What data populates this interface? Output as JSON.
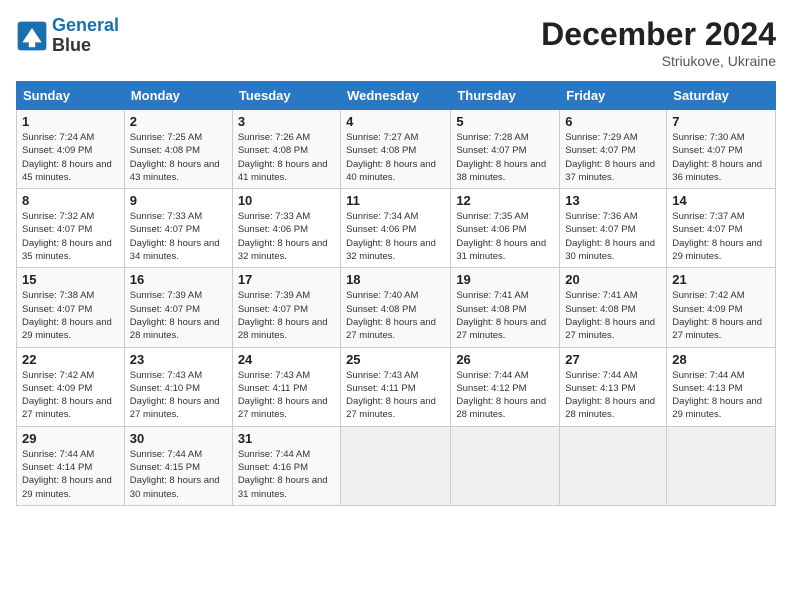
{
  "header": {
    "logo_line1": "General",
    "logo_line2": "Blue",
    "month": "December 2024",
    "location": "Striukove, Ukraine"
  },
  "weekdays": [
    "Sunday",
    "Monday",
    "Tuesday",
    "Wednesday",
    "Thursday",
    "Friday",
    "Saturday"
  ],
  "weeks": [
    [
      {
        "day": 1,
        "sunrise": "7:24 AM",
        "sunset": "4:09 PM",
        "daylight": "8 hours and 45 minutes."
      },
      {
        "day": 2,
        "sunrise": "7:25 AM",
        "sunset": "4:08 PM",
        "daylight": "8 hours and 43 minutes."
      },
      {
        "day": 3,
        "sunrise": "7:26 AM",
        "sunset": "4:08 PM",
        "daylight": "8 hours and 41 minutes."
      },
      {
        "day": 4,
        "sunrise": "7:27 AM",
        "sunset": "4:08 PM",
        "daylight": "8 hours and 40 minutes."
      },
      {
        "day": 5,
        "sunrise": "7:28 AM",
        "sunset": "4:07 PM",
        "daylight": "8 hours and 38 minutes."
      },
      {
        "day": 6,
        "sunrise": "7:29 AM",
        "sunset": "4:07 PM",
        "daylight": "8 hours and 37 minutes."
      },
      {
        "day": 7,
        "sunrise": "7:30 AM",
        "sunset": "4:07 PM",
        "daylight": "8 hours and 36 minutes."
      }
    ],
    [
      {
        "day": 8,
        "sunrise": "7:32 AM",
        "sunset": "4:07 PM",
        "daylight": "8 hours and 35 minutes."
      },
      {
        "day": 9,
        "sunrise": "7:33 AM",
        "sunset": "4:07 PM",
        "daylight": "8 hours and 34 minutes."
      },
      {
        "day": 10,
        "sunrise": "7:33 AM",
        "sunset": "4:06 PM",
        "daylight": "8 hours and 32 minutes."
      },
      {
        "day": 11,
        "sunrise": "7:34 AM",
        "sunset": "4:06 PM",
        "daylight": "8 hours and 32 minutes."
      },
      {
        "day": 12,
        "sunrise": "7:35 AM",
        "sunset": "4:06 PM",
        "daylight": "8 hours and 31 minutes."
      },
      {
        "day": 13,
        "sunrise": "7:36 AM",
        "sunset": "4:07 PM",
        "daylight": "8 hours and 30 minutes."
      },
      {
        "day": 14,
        "sunrise": "7:37 AM",
        "sunset": "4:07 PM",
        "daylight": "8 hours and 29 minutes."
      }
    ],
    [
      {
        "day": 15,
        "sunrise": "7:38 AM",
        "sunset": "4:07 PM",
        "daylight": "8 hours and 29 minutes."
      },
      {
        "day": 16,
        "sunrise": "7:39 AM",
        "sunset": "4:07 PM",
        "daylight": "8 hours and 28 minutes."
      },
      {
        "day": 17,
        "sunrise": "7:39 AM",
        "sunset": "4:07 PM",
        "daylight": "8 hours and 28 minutes."
      },
      {
        "day": 18,
        "sunrise": "7:40 AM",
        "sunset": "4:08 PM",
        "daylight": "8 hours and 27 minutes."
      },
      {
        "day": 19,
        "sunrise": "7:41 AM",
        "sunset": "4:08 PM",
        "daylight": "8 hours and 27 minutes."
      },
      {
        "day": 20,
        "sunrise": "7:41 AM",
        "sunset": "4:08 PM",
        "daylight": "8 hours and 27 minutes."
      },
      {
        "day": 21,
        "sunrise": "7:42 AM",
        "sunset": "4:09 PM",
        "daylight": "8 hours and 27 minutes."
      }
    ],
    [
      {
        "day": 22,
        "sunrise": "7:42 AM",
        "sunset": "4:09 PM",
        "daylight": "8 hours and 27 minutes."
      },
      {
        "day": 23,
        "sunrise": "7:43 AM",
        "sunset": "4:10 PM",
        "daylight": "8 hours and 27 minutes."
      },
      {
        "day": 24,
        "sunrise": "7:43 AM",
        "sunset": "4:11 PM",
        "daylight": "8 hours and 27 minutes."
      },
      {
        "day": 25,
        "sunrise": "7:43 AM",
        "sunset": "4:11 PM",
        "daylight": "8 hours and 27 minutes."
      },
      {
        "day": 26,
        "sunrise": "7:44 AM",
        "sunset": "4:12 PM",
        "daylight": "8 hours and 28 minutes."
      },
      {
        "day": 27,
        "sunrise": "7:44 AM",
        "sunset": "4:13 PM",
        "daylight": "8 hours and 28 minutes."
      },
      {
        "day": 28,
        "sunrise": "7:44 AM",
        "sunset": "4:13 PM",
        "daylight": "8 hours and 29 minutes."
      }
    ],
    [
      {
        "day": 29,
        "sunrise": "7:44 AM",
        "sunset": "4:14 PM",
        "daylight": "8 hours and 29 minutes."
      },
      {
        "day": 30,
        "sunrise": "7:44 AM",
        "sunset": "4:15 PM",
        "daylight": "8 hours and 30 minutes."
      },
      {
        "day": 31,
        "sunrise": "7:44 AM",
        "sunset": "4:16 PM",
        "daylight": "8 hours and 31 minutes."
      },
      null,
      null,
      null,
      null
    ]
  ]
}
